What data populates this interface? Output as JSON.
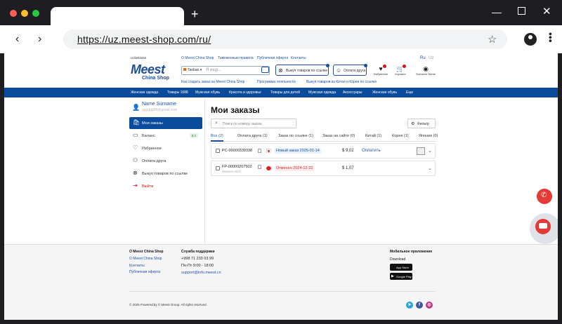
{
  "browser": {
    "url": "https://uz.meest-shop.com/ru/"
  },
  "header": {
    "country": "Uzbekistan",
    "top_links": [
      "O Meest China Shop",
      "Таможенные правила",
      "Публичная оферта",
      "Контакты"
    ],
    "langs": [
      "Ru",
      "Uz"
    ],
    "logo_main": "Meest",
    "logo_sub": "China Shop",
    "search_source": "Taobao",
    "search_placeholder": "Я ищу...",
    "btn_buyout": "Выкуп товаров по ссылке",
    "btn_pay_friend": "Оплата друга",
    "icons": {
      "favorites": "Избранное",
      "cart": "Корзина",
      "user": "Surname Name"
    },
    "sub_links": [
      "Как создать заказ на Meest China Shop",
      "Программа лояльности",
      "Выкуп товаров из Китая и Кореи по ссылке"
    ]
  },
  "categories": [
    "Женская одежда",
    "Товары 1688",
    "Мужская обувь",
    "Красота и здоровье",
    "Товары для детей",
    "Мужская одежда",
    "Аксессуары",
    "Женская обувь",
    "Еще"
  ],
  "sidebar": {
    "name": "Name Surname",
    "email": "gggggg58@gmail.com",
    "items": [
      {
        "label": "Мои заказы",
        "icon": "bag-icon"
      },
      {
        "label": "Баланс",
        "icon": "wallet-icon",
        "badge": "$ 0"
      },
      {
        "label": "Избранное",
        "icon": "heart-icon"
      },
      {
        "label": "Оплата друга",
        "icon": "friends-icon"
      },
      {
        "label": "Выкуп товаров по ссылке",
        "icon": "link-icon"
      },
      {
        "label": "Выйти",
        "icon": "logout-icon"
      }
    ]
  },
  "main": {
    "title": "Мои заказы",
    "search_placeholder": "Поиск по номеру заказа",
    "filter_label": "Фильтр",
    "tabs": [
      "Все (2)",
      "Оплата друга (1)",
      "Заказ по ссылке (1)",
      "Заказ на сайте (0)",
      "Китай (1)",
      "Корея (1)",
      "Япония (0)"
    ],
    "orders": [
      {
        "number": "PC-00000339338",
        "sub": "",
        "status": "Новый заказ 2025-01-14",
        "price": "$ 9,02",
        "action": "Оплатить"
      },
      {
        "number": "FP-00000207502",
        "sub": "3800004+2022",
        "status": "Отменен 2024-12-22",
        "price": "$ 1,07",
        "action": ""
      }
    ]
  },
  "footer": {
    "col1_title": "O Meest China Shop",
    "col1_links": [
      "O Meest China Shop",
      "Контакты",
      "Публичная оферта"
    ],
    "col2_title": "Служба поддержки",
    "phone": "+998 71 233 03 99",
    "hours": "Пн-Пт 9:00 - 18:00",
    "email": "support@info.meest.cn",
    "col3_title": "Мобильное приложение",
    "download": "Download",
    "app_store": "App Store",
    "google_play": "Google Play",
    "copyright": "© 2025 Powered by © Meest Group. All rights reserved."
  }
}
